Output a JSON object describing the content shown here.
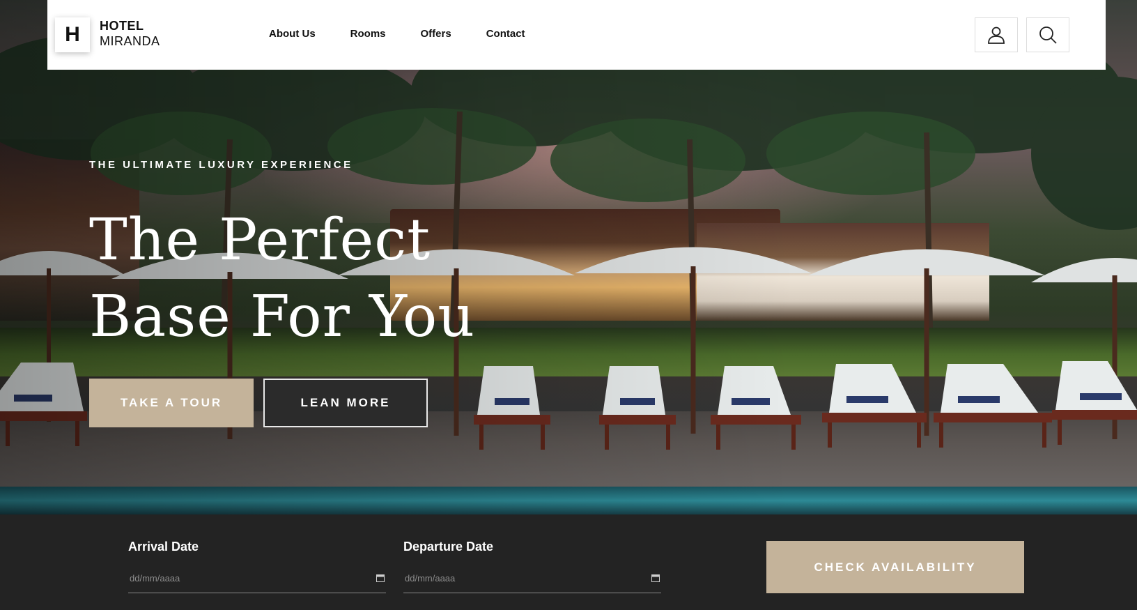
{
  "brand": {
    "logo_letter": "H",
    "line1": "HOTEL",
    "line2": "MIRANDA"
  },
  "nav": {
    "items": [
      "About Us",
      "Rooms",
      "Offers",
      "Contact"
    ]
  },
  "header_icons": {
    "user": "user-icon",
    "search": "search-icon"
  },
  "hero": {
    "eyebrow": "THE ULTIMATE LUXURY EXPERIENCE",
    "headline_line1": "The Perfect",
    "headline_line2": "Base For You",
    "primary_button": "TAKE A TOUR",
    "secondary_button": "LEAN MORE"
  },
  "booking": {
    "arrival_label": "Arrival Date",
    "arrival_placeholder": "dd/mm/aaaa",
    "departure_label": "Departure Date",
    "departure_placeholder": "dd/mm/aaaa",
    "submit_label": "CHECK AVAILABILITY"
  },
  "colors": {
    "accent": "#c4b39a",
    "dark": "#232323",
    "white": "#ffffff"
  }
}
